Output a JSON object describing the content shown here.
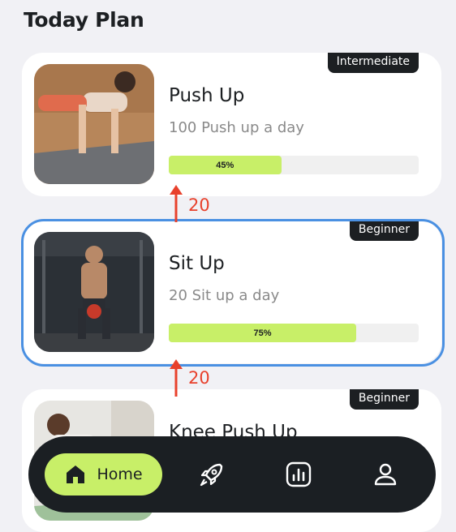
{
  "page": {
    "title": "Today Plan"
  },
  "plans": [
    {
      "title": "Push Up",
      "subtitle": "100 Push up a day",
      "level": "Intermediate",
      "progress": 45,
      "progress_label": "45%"
    },
    {
      "title": "Sit Up",
      "subtitle": "20 Sit up a day",
      "level": "Beginner",
      "progress": 75,
      "progress_label": "75%"
    },
    {
      "title": "Knee Push Up",
      "level": "Beginner"
    }
  ],
  "annotations": [
    {
      "label": "20"
    },
    {
      "label": "20"
    }
  ],
  "nav": {
    "home_label": "Home",
    "icons": [
      "home-icon",
      "rocket-icon",
      "chart-icon",
      "profile-icon"
    ],
    "accent": "#c8ef68",
    "background": "#1b1f23"
  },
  "colors": {
    "highlight": "#4a90e2",
    "annotation": "#e8412c",
    "progress_fill": "#c8ef68"
  }
}
